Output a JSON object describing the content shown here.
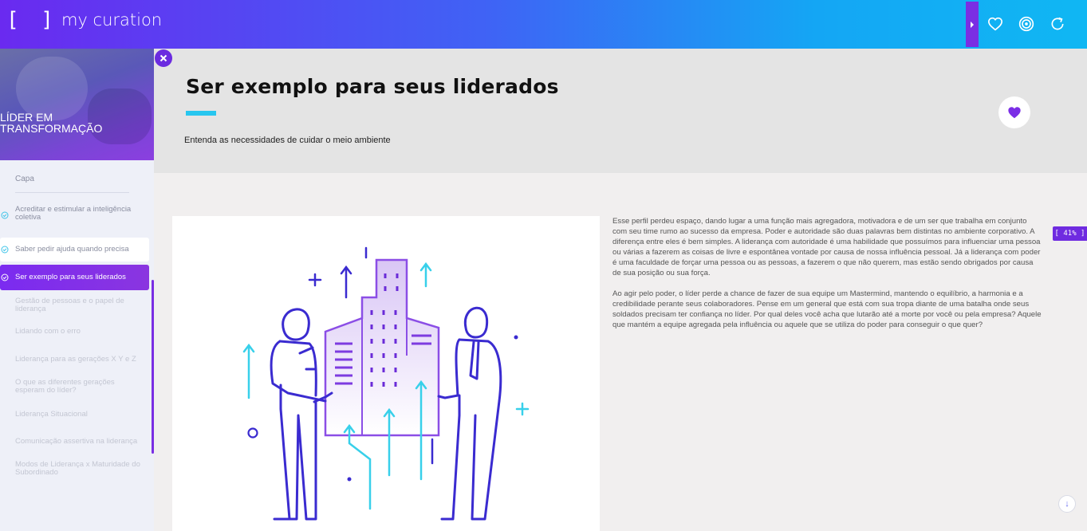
{
  "header": {
    "logo_bracket": "[ ]",
    "logo_text": "my curation",
    "icons": [
      "chevron-right-icon",
      "heart-icon",
      "target-icon",
      "refresh-icon"
    ]
  },
  "sidebar": {
    "course_title_line1": "LÍDER EM",
    "course_title_line2": "TRANSFORMAÇÃO",
    "capa": "Capa",
    "items": [
      {
        "label": "Acreditar e estimular a inteligência coletiva",
        "state": "done"
      },
      {
        "label": "Saber pedir ajuda quando precisa",
        "state": "done"
      },
      {
        "label": "Ser exemplo para seus liderados",
        "state": "active"
      },
      {
        "label": "Gestão de pessoas e o papel de liderança",
        "state": "todo"
      },
      {
        "label": "Lidando com o erro",
        "state": "todo"
      },
      {
        "label": "Liderança para as gerações X Y e Z",
        "state": "todo"
      },
      {
        "label": "O que as diferentes gerações esperam do líder?",
        "state": "todo"
      },
      {
        "label": "Liderança Situacional",
        "state": "todo"
      },
      {
        "label": "Comunicação assertiva na liderança",
        "state": "todo"
      },
      {
        "label": "Modos de Liderança x Maturidade do Subordinado",
        "state": "todo"
      }
    ]
  },
  "hero": {
    "title": "Ser exemplo para seus liderados",
    "subtitle": "Entenda as necessidades de cuidar o meio ambiente"
  },
  "article": {
    "paragraph1": "Esse perfil perdeu espaço, dando lugar a uma função mais agregadora, motivadora e de um ser que trabalha em conjunto com seu time rumo ao sucesso da empresa. Poder e autoridade são duas palavras bem distintas no ambiente corporativo. A diferença entre eles é bem simples. A liderança com autoridade é uma habilidade que possuímos para influenciar uma pessoa ou várias a fazerem as coisas de livre e espontânea vontade por causa de nossa influência pessoal. Já a liderança com poder é uma faculdade de forçar uma pessoa ou as pessoas, a fazerem o que não querem, mas estão sendo obrigados por causa de sua posição ou sua força.",
    "paragraph2": "Ao agir pelo poder, o líder perde a chance de fazer de sua equipe um Mastermind, mantendo o equilíbrio, a harmonia e a credibilidade perante seus colaboradores. Pense em um general que está com sua tropa diante de uma batalha onde seus soldados precisam ter confiança no líder. Por qual deles você acha que lutarão até a morte por você ou pela empresa? Aquele que mantém a equipe agregada pela influência ou aquele que se utiliza do poder para conseguir o que quer?"
  },
  "progress": {
    "text": "[ 41% ]",
    "value": 41
  },
  "scroll_down_label": "↓",
  "colors": {
    "accent_purple": "#6f2be0",
    "accent_cyan": "#27c6ef"
  }
}
